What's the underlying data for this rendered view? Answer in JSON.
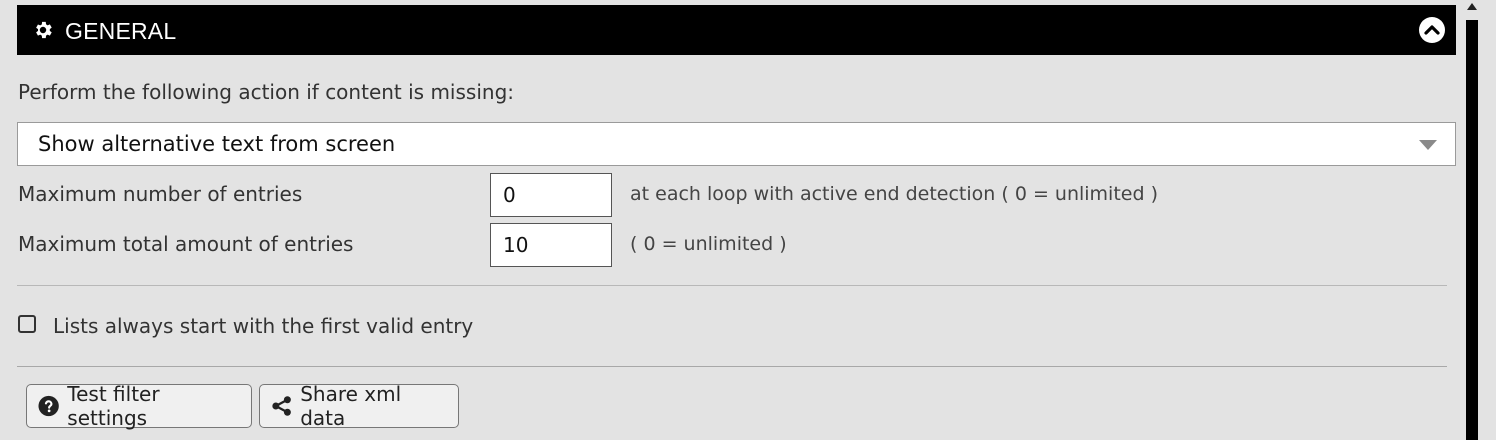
{
  "header": {
    "title": "GENERAL",
    "icon": "gear-icon",
    "collapse_icon": "chevron-up-icon"
  },
  "missing_content": {
    "label": "Perform the following action if content is missing:",
    "selected": "Show alternative text from screen"
  },
  "max_entries": {
    "label": "Maximum number of entries",
    "value": "0",
    "hint": "at each loop with active end detection ( 0 = unlimited )"
  },
  "max_total": {
    "label": "Maximum total amount of entries",
    "value": "10",
    "hint": "( 0 = unlimited )"
  },
  "lists_start": {
    "label": "Lists always start with the first valid entry",
    "checked": false
  },
  "buttons": {
    "test_label": "Test filter settings",
    "share_label": "Share xml data"
  },
  "colors": {
    "header_bg": "#000000",
    "page_bg": "#e3e3e3"
  }
}
